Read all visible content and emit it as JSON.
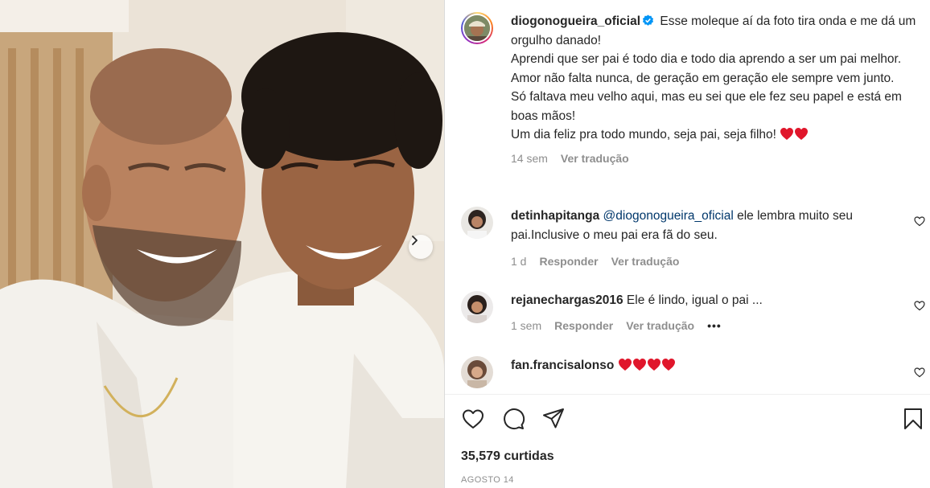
{
  "post": {
    "author": "diogonogueira_oficial",
    "caption_lines": [
      "Esse moleque aí da foto tira onda e me dá um orgulho danado!",
      "Aprendi que ser pai é todo dia e todo dia aprendo a ser um pai melhor. Amor não falta nunca, de geração em geração ele sempre vem junto.",
      "Só faltava meu velho aqui, mas eu sei que ele fez seu papel e está em boas mãos!",
      "Um dia feliz pra todo mundo, seja pai, seja filho!"
    ],
    "time": "14 sem",
    "translate": "Ver tradução"
  },
  "comments": [
    {
      "user": "detinhapitanga",
      "mention": "@diogonogueira_oficial",
      "text": " ele lembra muito seu pai.Inclusive o meu pai era fã do seu.",
      "time": "1 d",
      "reply": "Responder",
      "translate": "Ver tradução",
      "avatar": "avatar-detinhapitanga"
    },
    {
      "user": "rejanechargas2016",
      "mention": "",
      "text": "Ele é lindo, igual o pai ...",
      "time": "1 sem",
      "reply": "Responder",
      "translate": "Ver tradução",
      "more": "•••",
      "avatar": "avatar-rejanechargas2016"
    },
    {
      "user": "fan.francisalonso",
      "mention": "",
      "text": "",
      "time": "",
      "reply": "",
      "translate": "",
      "avatar": "avatar-fan-francisalonso"
    }
  ],
  "likes": "35,579 curtidas",
  "date": "AGOSTO 14",
  "icons": {
    "like": "heart-outline-icon",
    "comment": "comment-bubble-icon",
    "share": "paper-plane-icon",
    "save": "bookmark-icon",
    "verified": "verified-badge-icon",
    "next": "chevron-right-icon"
  },
  "colors": {
    "heart_emoji": "#e0162b",
    "verified": "#0095f6",
    "text": "#262626",
    "muted": "#8e8e8e",
    "mention": "#00376b"
  }
}
